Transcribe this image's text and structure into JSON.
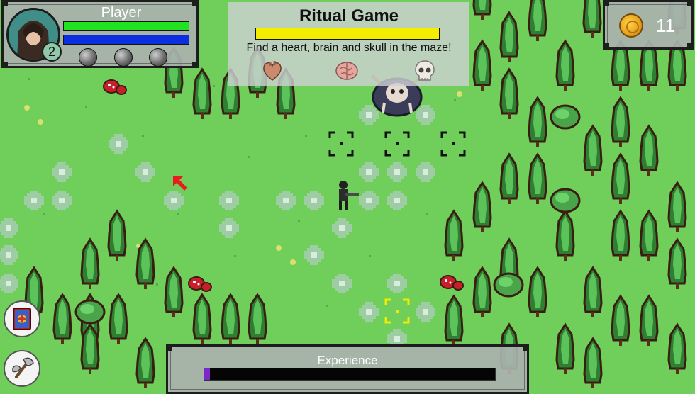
{
  "player": {
    "name": "Player",
    "level": "2",
    "health_fraction": 1.0,
    "mana_fraction": 1.0,
    "health_color": "#21e221",
    "mana_color": "#0b2fe0",
    "ability_orbs": [
      "grey-orb",
      "grey-orb",
      "grey-orb"
    ]
  },
  "quest": {
    "title": "Ritual Game",
    "description": "Find a heart, brain and skull in the maze!",
    "progress_fraction": 1.0,
    "progress_color": "#f3ee00",
    "items": [
      "heart-icon",
      "brain-icon",
      "skull-icon"
    ]
  },
  "currency": {
    "icon": "coin-icon",
    "amount": "11"
  },
  "experience": {
    "label": "Experience",
    "progress_fraction": 0.02,
    "color": "#7a28c8"
  },
  "side_buttons": [
    {
      "icon": "spellbook-icon"
    },
    {
      "icon": "axe-icon"
    }
  ]
}
